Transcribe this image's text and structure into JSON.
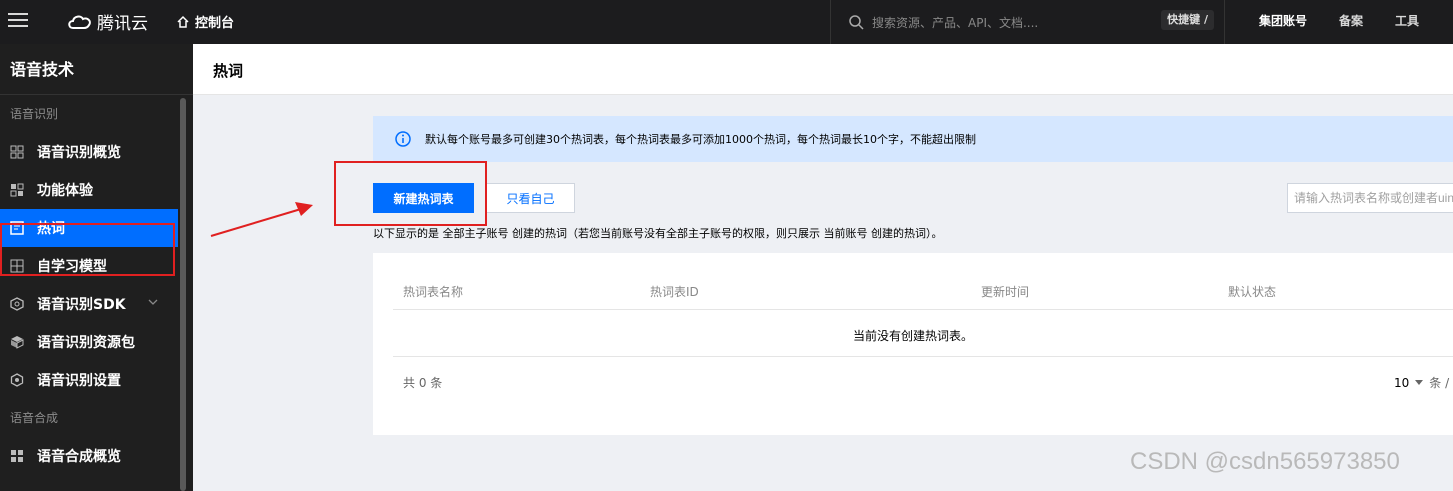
{
  "topbar": {
    "logo_text": "腾讯云",
    "console_label": "控制台",
    "search_placeholder": "搜索资源、产品、API、文档....",
    "shortcut_label": "快捷键 /",
    "links": [
      "集团账号",
      "备案",
      "工具"
    ]
  },
  "sidebar": {
    "title": "语音技术",
    "section_asr": "语音识别",
    "items": [
      {
        "label": "语音识别概览",
        "icon": "overview-grid-icon"
      },
      {
        "label": "功能体验",
        "icon": "apps-icon"
      },
      {
        "label": "热词",
        "icon": "hotword-icon",
        "active": true
      },
      {
        "label": "自学习模型",
        "icon": "model-icon"
      },
      {
        "label": "语音识别SDK",
        "icon": "sdk-icon",
        "expandable": true
      },
      {
        "label": "语音识别资源包",
        "icon": "package-icon"
      },
      {
        "label": "语音识别设置",
        "icon": "settings-icon"
      }
    ],
    "section_tts": "语音合成",
    "tts_items": [
      {
        "label": "语音合成概览",
        "icon": "overview-grid-icon"
      }
    ]
  },
  "page": {
    "title": "热词",
    "notice": "默认每个账号最多可创建30个热词表，每个热词表最多可添加1000个热词，每个热词最长10个字，不能超出限制",
    "create_button": "新建热词表",
    "mine_button": "只看自己",
    "filter_placeholder": "请输入热词表名称或创建者uin",
    "description": "以下显示的是 全部主子账号 创建的热词（若您当前账号没有全部主子账号的权限，则只展示 当前账号 创建的热词）。",
    "table": {
      "columns": [
        "热词表名称",
        "热词表ID",
        "更新时间",
        "默认状态"
      ],
      "empty_text": "当前没有创建热词表。",
      "total_text": "共  0  条",
      "page_size": "10",
      "page_size_unit": "条 /"
    }
  },
  "watermark": "CSDN @csdn565973850",
  "colors": {
    "primary": "#006eff",
    "topbar_bg": "#1c1c1e",
    "sidebar_bg": "#1f1f1f",
    "notice_bg": "#d5e7ff",
    "annotation": "#e02020"
  }
}
